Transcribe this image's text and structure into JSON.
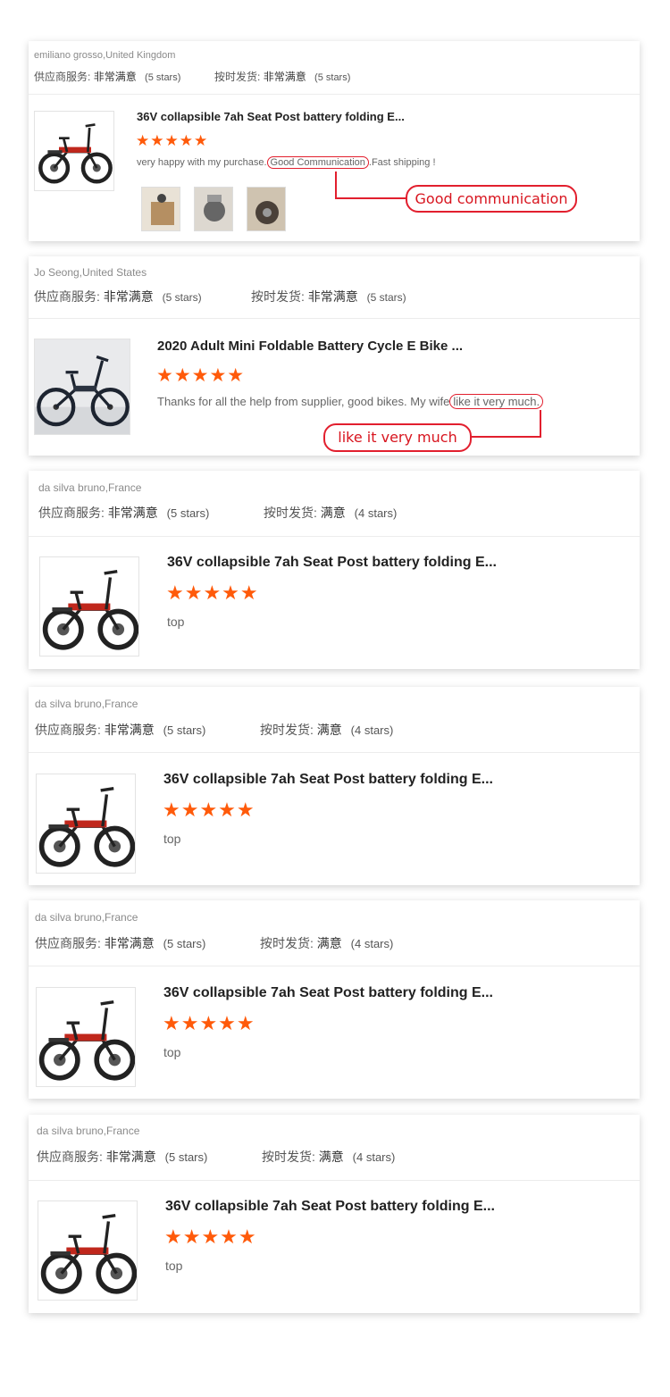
{
  "reviews": [
    {
      "reviewer": "emiliano grosso,United Kingdom",
      "supplier_label": "供应商服务:",
      "supplier_value": "非常满意",
      "supplier_stars": "(5 stars)",
      "ontime_label": "按时发货:",
      "ontime_value": "非常满意",
      "ontime_stars": "(5 stars)",
      "product_title": "36V collapsible 7ah Seat Post battery folding E...",
      "rating": "★★★★★",
      "comment_before": "very happy with my purchase.",
      "comment_highlight": "Good Communication",
      "comment_after": ".Fast shipping !",
      "callout": "Good communication"
    },
    {
      "reviewer": "Jo Seong,United States",
      "supplier_label": "供应商服务:",
      "supplier_value": "非常满意",
      "supplier_stars": "(5 stars)",
      "ontime_label": "按时发货:",
      "ontime_value": "非常满意",
      "ontime_stars": "(5 stars)",
      "product_title": "2020 Adult Mini Foldable Battery Cycle E Bike ...",
      "rating": "★★★★★",
      "comment_before": "Thanks for all the help from supplier, good bikes. My wife",
      "comment_highlight": "like it very much.",
      "comment_after": "",
      "callout": "like it very much"
    },
    {
      "reviewer": "da silva bruno,France",
      "supplier_label": "供应商服务:",
      "supplier_value": "非常满意",
      "supplier_stars": "(5 stars)",
      "ontime_label": "按时发货:",
      "ontime_value": "满意",
      "ontime_stars": "(4 stars)",
      "product_title": "36V collapsible 7ah Seat Post battery folding E...",
      "rating": "★★★★★",
      "comment": "top"
    },
    {
      "reviewer": "da silva bruno,France",
      "supplier_label": "供应商服务:",
      "supplier_value": "非常满意",
      "supplier_stars": "(5 stars)",
      "ontime_label": "按时发货:",
      "ontime_value": "满意",
      "ontime_stars": "(4 stars)",
      "product_title": "36V collapsible 7ah Seat Post battery folding E...",
      "rating": "★★★★★",
      "comment": "top"
    },
    {
      "reviewer": "da silva bruno,France",
      "supplier_label": "供应商服务:",
      "supplier_value": "非常满意",
      "supplier_stars": "(5 stars)",
      "ontime_label": "按时发货:",
      "ontime_value": "满意",
      "ontime_stars": "(4 stars)",
      "product_title": "36V collapsible 7ah Seat Post battery folding E...",
      "rating": "★★★★★",
      "comment": "top"
    },
    {
      "reviewer": "da silva bruno,France",
      "supplier_label": "供应商服务:",
      "supplier_value": "非常满意",
      "supplier_stars": "(5 stars)",
      "ontime_label": "按时发货:",
      "ontime_value": "满意",
      "ontime_stars": "(4 stars)",
      "product_title": "36V collapsible 7ah Seat Post battery folding E...",
      "rating": "★★★★★",
      "comment": "top"
    }
  ],
  "colors": {
    "star": "#ff5a0a",
    "highlight": "#e21f2e"
  }
}
